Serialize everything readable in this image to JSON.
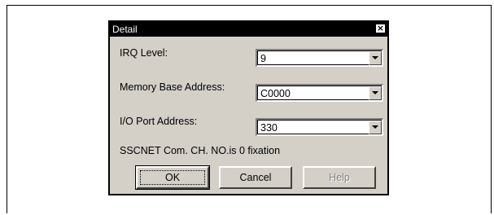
{
  "dialog": {
    "title": "Detail",
    "close_glyph": "×",
    "fields": [
      {
        "label": "IRQ Level:",
        "value": "9"
      },
      {
        "label": "Memory Base Address:",
        "value": "C0000"
      },
      {
        "label": "I/O Port Address:",
        "value": "330"
      }
    ],
    "note": "SSCNET Com. CH. NO.is 0 fixation",
    "buttons": {
      "ok": "OK",
      "cancel": "Cancel",
      "help": "Help"
    }
  }
}
